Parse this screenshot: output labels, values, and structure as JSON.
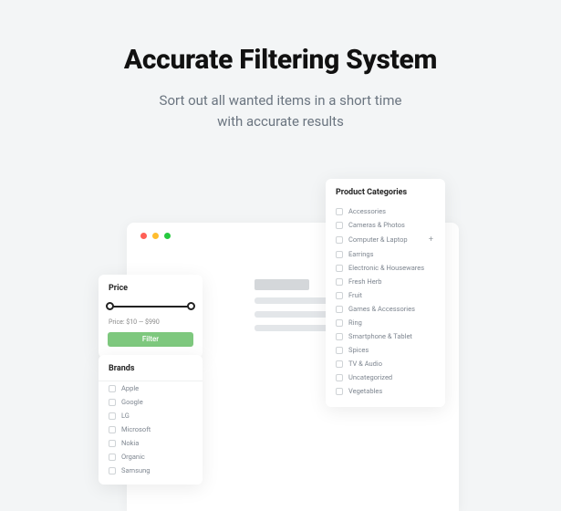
{
  "hero": {
    "title": "Accurate Filtering System",
    "subtitle_line1": "Sort out all wanted items in a short time",
    "subtitle_line2": "with accurate results"
  },
  "price_panel": {
    "heading": "Price",
    "range_text": "Price: $10 — $990",
    "button": "Filter"
  },
  "brands_panel": {
    "heading": "Brands",
    "items": [
      "Apple",
      "Google",
      "LG",
      "Microsoft",
      "Nokia",
      "Organic",
      "Samsung"
    ]
  },
  "categories_panel": {
    "heading": "Product Categories",
    "items": [
      {
        "label": "Accessories",
        "expandable": false
      },
      {
        "label": "Cameras & Photos",
        "expandable": false
      },
      {
        "label": "Computer & Laptop",
        "expandable": true
      },
      {
        "label": "Earrings",
        "expandable": false
      },
      {
        "label": "Electronic & Housewares",
        "expandable": false
      },
      {
        "label": "Fresh Herb",
        "expandable": false
      },
      {
        "label": "Fruit",
        "expandable": false
      },
      {
        "label": "Games & Accessories",
        "expandable": false
      },
      {
        "label": "Ring",
        "expandable": false
      },
      {
        "label": "Smartphone & Tablet",
        "expandable": false
      },
      {
        "label": "Spices",
        "expandable": false
      },
      {
        "label": "TV & Audio",
        "expandable": false
      },
      {
        "label": "Uncategorized",
        "expandable": false
      },
      {
        "label": "Vegetables",
        "expandable": false
      }
    ]
  }
}
